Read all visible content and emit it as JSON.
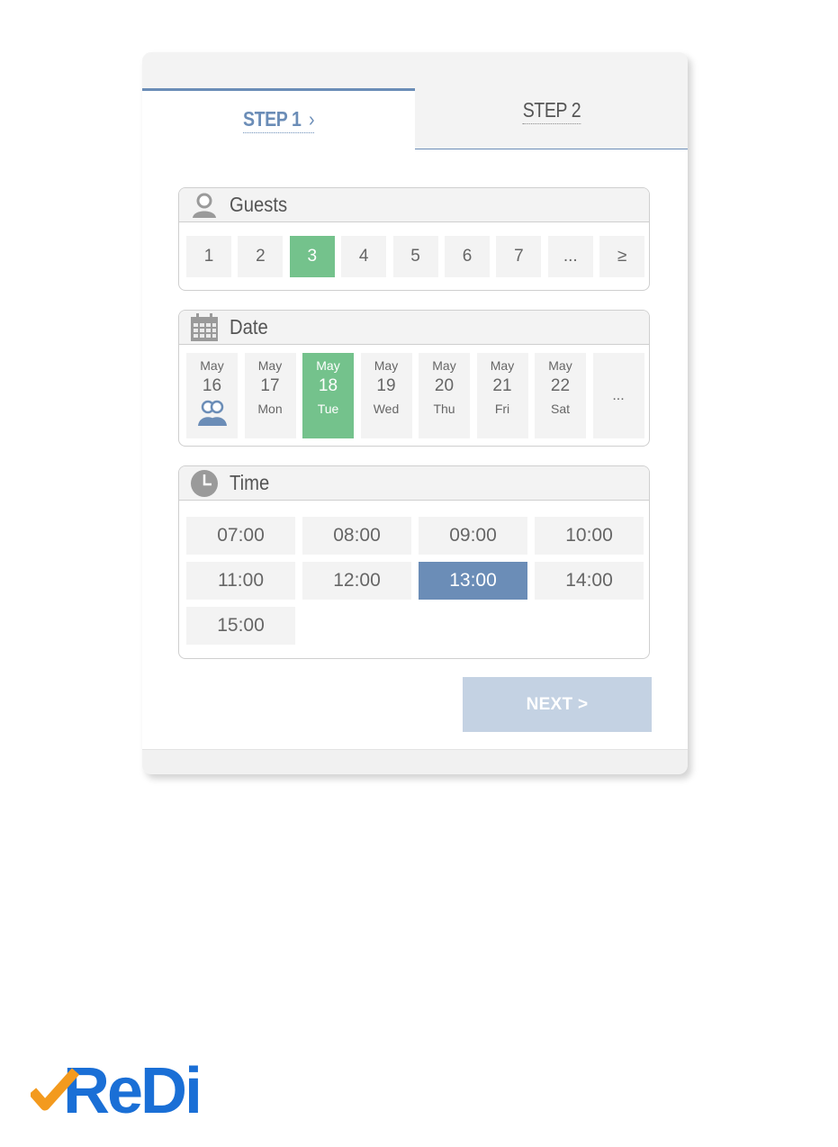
{
  "tabs": {
    "step1": "STEP 1",
    "step2": "STEP 2"
  },
  "guests": {
    "title": "Guests",
    "options": [
      "1",
      "2",
      "3",
      "4",
      "5",
      "6",
      "7",
      "...",
      "≥"
    ],
    "selected": "3"
  },
  "date": {
    "title": "Date",
    "days": [
      {
        "month": "May",
        "day": "16",
        "weekday": ""
      },
      {
        "month": "May",
        "day": "17",
        "weekday": "Mon"
      },
      {
        "month": "May",
        "day": "18",
        "weekday": "Tue"
      },
      {
        "month": "May",
        "day": "19",
        "weekday": "Wed"
      },
      {
        "month": "May",
        "day": "20",
        "weekday": "Thu"
      },
      {
        "month": "May",
        "day": "21",
        "weekday": "Fri"
      },
      {
        "month": "May",
        "day": "22",
        "weekday": "Sat"
      }
    ],
    "more": "...",
    "selected_day": "18"
  },
  "time": {
    "title": "Time",
    "slots": [
      "07:00",
      "08:00",
      "09:00",
      "10:00",
      "11:00",
      "12:00",
      "13:00",
      "14:00",
      "15:00"
    ],
    "selected": "13:00"
  },
  "next_button": "NEXT >",
  "logo": {
    "text": "ReDi"
  },
  "colors": {
    "accent_blue": "#6b8db7",
    "selected_green": "#74c28c",
    "button_disabled": "#c4d2e3",
    "logo_blue": "#1a6fd6",
    "logo_orange": "#f39a1e"
  }
}
